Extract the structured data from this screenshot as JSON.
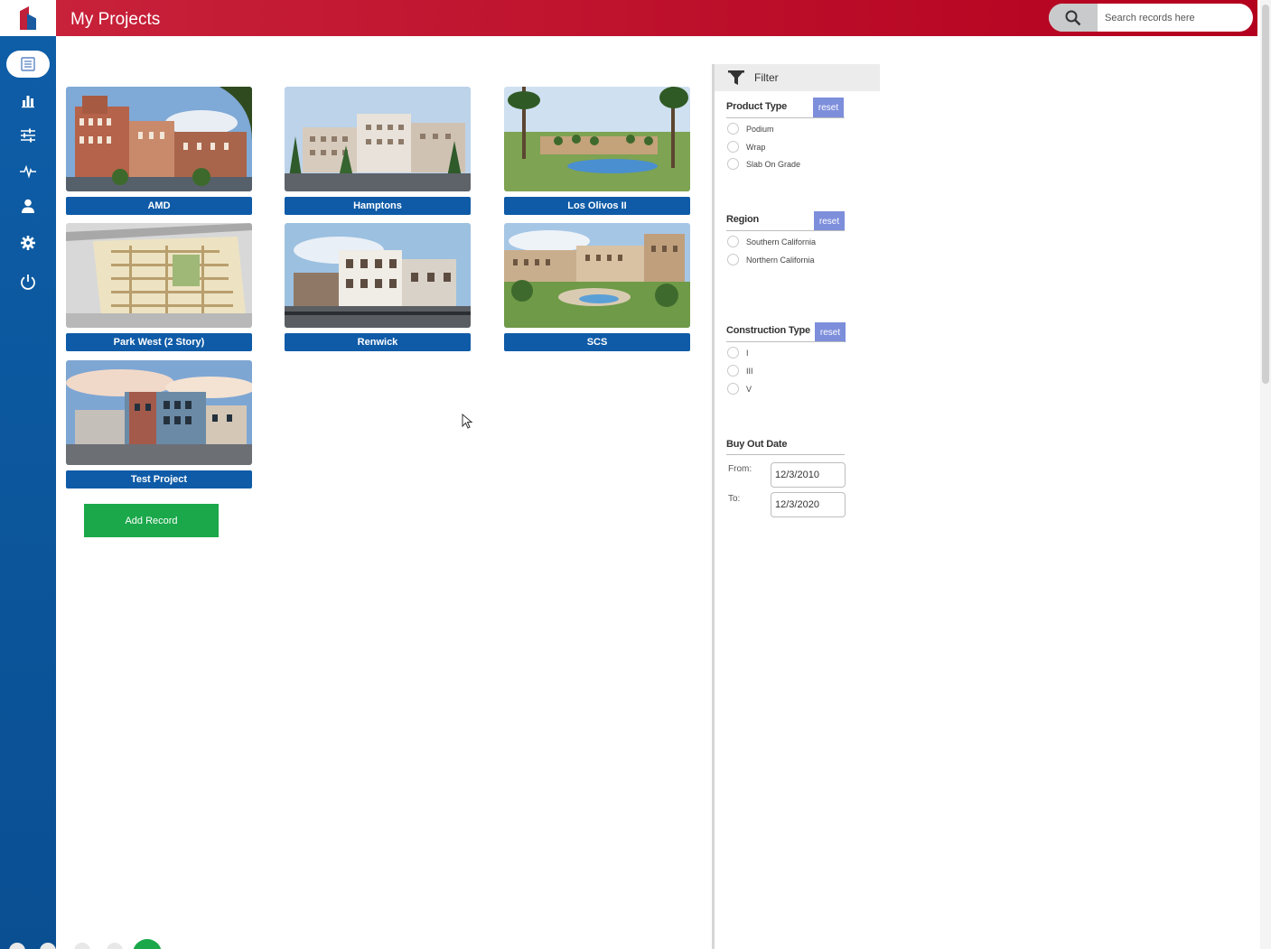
{
  "header": {
    "title": "My Projects",
    "search_placeholder": "Search records here"
  },
  "sidebar": {
    "items": [
      {
        "name": "projects",
        "icon": "list-icon"
      },
      {
        "name": "reports",
        "icon": "bar-chart-icon"
      },
      {
        "name": "settings-sliders",
        "icon": "sliders-icon"
      },
      {
        "name": "activity",
        "icon": "pulse-icon"
      },
      {
        "name": "users",
        "icon": "user-icon"
      },
      {
        "name": "settings",
        "icon": "gear-icon"
      },
      {
        "name": "logout",
        "icon": "power-icon"
      }
    ]
  },
  "projects": [
    {
      "name": "AMD"
    },
    {
      "name": "Hamptons"
    },
    {
      "name": "Los Olivos II"
    },
    {
      "name": "Park West (2 Story)"
    },
    {
      "name": "Renwick"
    },
    {
      "name": "SCS"
    },
    {
      "name": "Test Project"
    }
  ],
  "add_record_label": "Add Record",
  "filter": {
    "title": "Filter",
    "reset_label": "reset",
    "product_type": {
      "title": "Product Type",
      "options": [
        "Podium",
        "Wrap",
        "Slab On Grade"
      ]
    },
    "region": {
      "title": "Region",
      "options": [
        "Southern California",
        "Northern California"
      ]
    },
    "construction_type": {
      "title": "Construction Type",
      "options": [
        "I",
        "III",
        "V"
      ]
    },
    "buy_out_date": {
      "title": "Buy Out Date",
      "from_label": "From:",
      "from_value": "12/3/2010",
      "to_label": "To:",
      "to_value": "12/3/2020"
    }
  },
  "colors": {
    "header": "#b3001e",
    "sidebar": "#0e5ea8",
    "card_label": "#0f5ba7",
    "add_button": "#1aa84a",
    "reset_button": "#7d8edb"
  }
}
